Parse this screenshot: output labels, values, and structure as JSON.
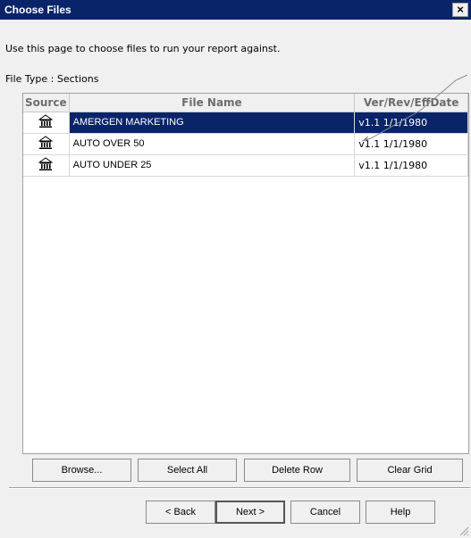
{
  "dialog": {
    "title": "Choose Files",
    "close_glyph": "×",
    "intro": "Use this page to choose files to run your report against.",
    "file_type": "File Type : Sections"
  },
  "grid": {
    "columns": [
      "Source",
      "File Name",
      "Ver/Rev/EffDate"
    ],
    "rows": [
      {
        "source_icon": "repository-icon",
        "file_name": "AMERGEN MARKETING",
        "ver": "v1.1 1/1/1980",
        "selected": true
      },
      {
        "source_icon": "repository-icon",
        "file_name": "AUTO OVER 50",
        "ver": "v1.1 1/1/1980",
        "selected": false
      },
      {
        "source_icon": "repository-icon",
        "file_name": "AUTO UNDER 25",
        "ver": "v1.1 1/1/1980",
        "selected": false
      }
    ]
  },
  "grid_buttons": {
    "browse": "Browse...",
    "select_all": "Select All",
    "delete_row": "Delete Row",
    "clear_grid": "Clear Grid"
  },
  "nav_buttons": {
    "back": "< Back",
    "next": "Next >",
    "cancel": "Cancel",
    "help": "Help"
  },
  "colors": {
    "title_bar": "#0a246a",
    "selection": "#0a246a",
    "window_bg": "#f0f0f0"
  }
}
